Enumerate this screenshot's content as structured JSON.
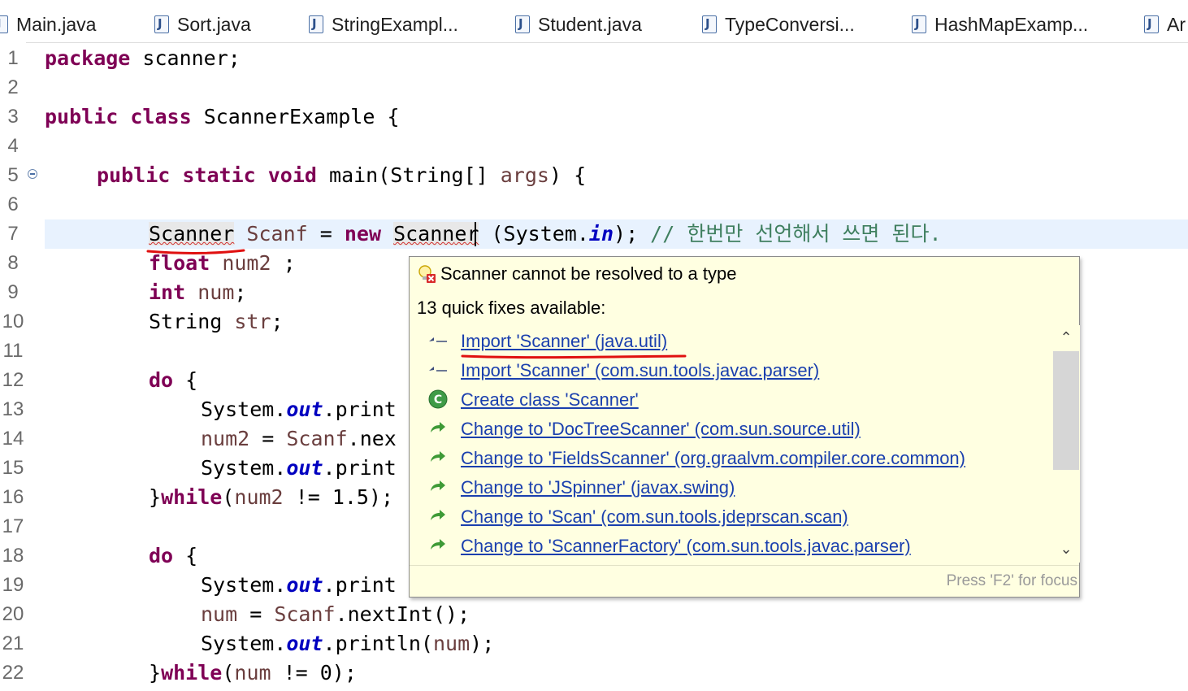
{
  "tabs": [
    {
      "label": "Main.java"
    },
    {
      "label": "Sort.java"
    },
    {
      "label": "StringExampl..."
    },
    {
      "label": "Student.java"
    },
    {
      "label": "TypeConversi..."
    },
    {
      "label": "HashMapExamp..."
    },
    {
      "label": "Ar"
    }
  ],
  "editor": {
    "line_numbers": [
      "1",
      "2",
      "3",
      "4",
      "5",
      "6",
      "7",
      "8",
      "9",
      "10",
      "11",
      "12",
      "13",
      "14",
      "15",
      "16",
      "17",
      "18",
      "19",
      "20",
      "21",
      "22"
    ],
    "line1": {
      "kw": "package",
      "rest": " scanner;"
    },
    "line3": {
      "kw1": "public",
      "kw2": "class",
      "rest": " ScannerExample {"
    },
    "line5": {
      "kw1": "public",
      "kw2": "static",
      "kw3": "void",
      "mid": " main(String[] ",
      "arg": "args",
      "end": ") {"
    },
    "line7": {
      "type": "Scanner",
      "var": "Scanf",
      "eq": " = ",
      "kw": "new",
      "type2a": "Scann",
      "type2b": "er",
      "args": " (System.",
      "fld": "in",
      "end": "); ",
      "comment": "// 한번만 선언해서 쓰면 된다."
    },
    "line8": {
      "kw": "float",
      "var": "num2",
      "end": " ;"
    },
    "line9": {
      "kw": "int",
      "var": "num",
      "end": ";"
    },
    "line10": {
      "type": "String ",
      "var": "str",
      "end": ";"
    },
    "line12": {
      "kw": "do",
      "end": " {"
    },
    "line13": {
      "pre": "System.",
      "fld": "out",
      "post": ".print"
    },
    "line14": {
      "var": "num2",
      "mid": " = ",
      "var2": "Scanf",
      "post": ".nex"
    },
    "line15": {
      "pre": "System.",
      "fld": "out",
      "post": ".print"
    },
    "line16": {
      "pre": "}",
      "kw": "while",
      "open": "(",
      "var": "num2",
      "post": " != 1.5);"
    },
    "line18": {
      "kw": "do",
      "end": " {"
    },
    "line19": {
      "pre": "System.",
      "fld": "out",
      "post": ".print"
    },
    "line20": {
      "var": "num",
      "mid": " = ",
      "var2": "Scanf",
      "post": ".nextInt();"
    },
    "line21": {
      "pre": "System.",
      "fld": "out",
      "post": ".println(",
      "var": "num",
      "end": ");"
    },
    "line22": {
      "pre": "}",
      "kw": "while",
      "open": "(",
      "var": "num",
      "post": " != 0);"
    }
  },
  "quickfix": {
    "title": "Scanner cannot be resolved to a type",
    "count_text": "13 quick fixes available:",
    "items": [
      {
        "label": "Import 'Scanner' (java.util)",
        "icon": "import-icon"
      },
      {
        "label": "Import 'Scanner' (com.sun.tools.javac.parser)",
        "icon": "import-icon"
      },
      {
        "label": "Create class 'Scanner'",
        "icon": "create-class-icon"
      },
      {
        "label": "Change to 'DocTreeScanner' (com.sun.source.util)",
        "icon": "change-arrow-icon"
      },
      {
        "label": "Change to 'FieldsScanner' (org.graalvm.compiler.core.common)",
        "icon": "change-arrow-icon"
      },
      {
        "label": "Change to 'JSpinner' (javax.swing)",
        "icon": "change-arrow-icon"
      },
      {
        "label": "Change to 'Scan' (com.sun.tools.jdeprscan.scan)",
        "icon": "change-arrow-icon"
      },
      {
        "label": "Change to 'ScannerFactory' (com.sun.tools.javac.parser)",
        "icon": "change-arrow-icon"
      }
    ],
    "footer_hint": "Press 'F2' for focus"
  },
  "colors": {
    "keyword": "#7f0055",
    "field": "#0000c0",
    "comment": "#3f7f5f",
    "variable": "#6a3e3e",
    "link": "#1a3fae",
    "popup_bg": "#ffffe1",
    "annotation_red": "#e01010"
  }
}
